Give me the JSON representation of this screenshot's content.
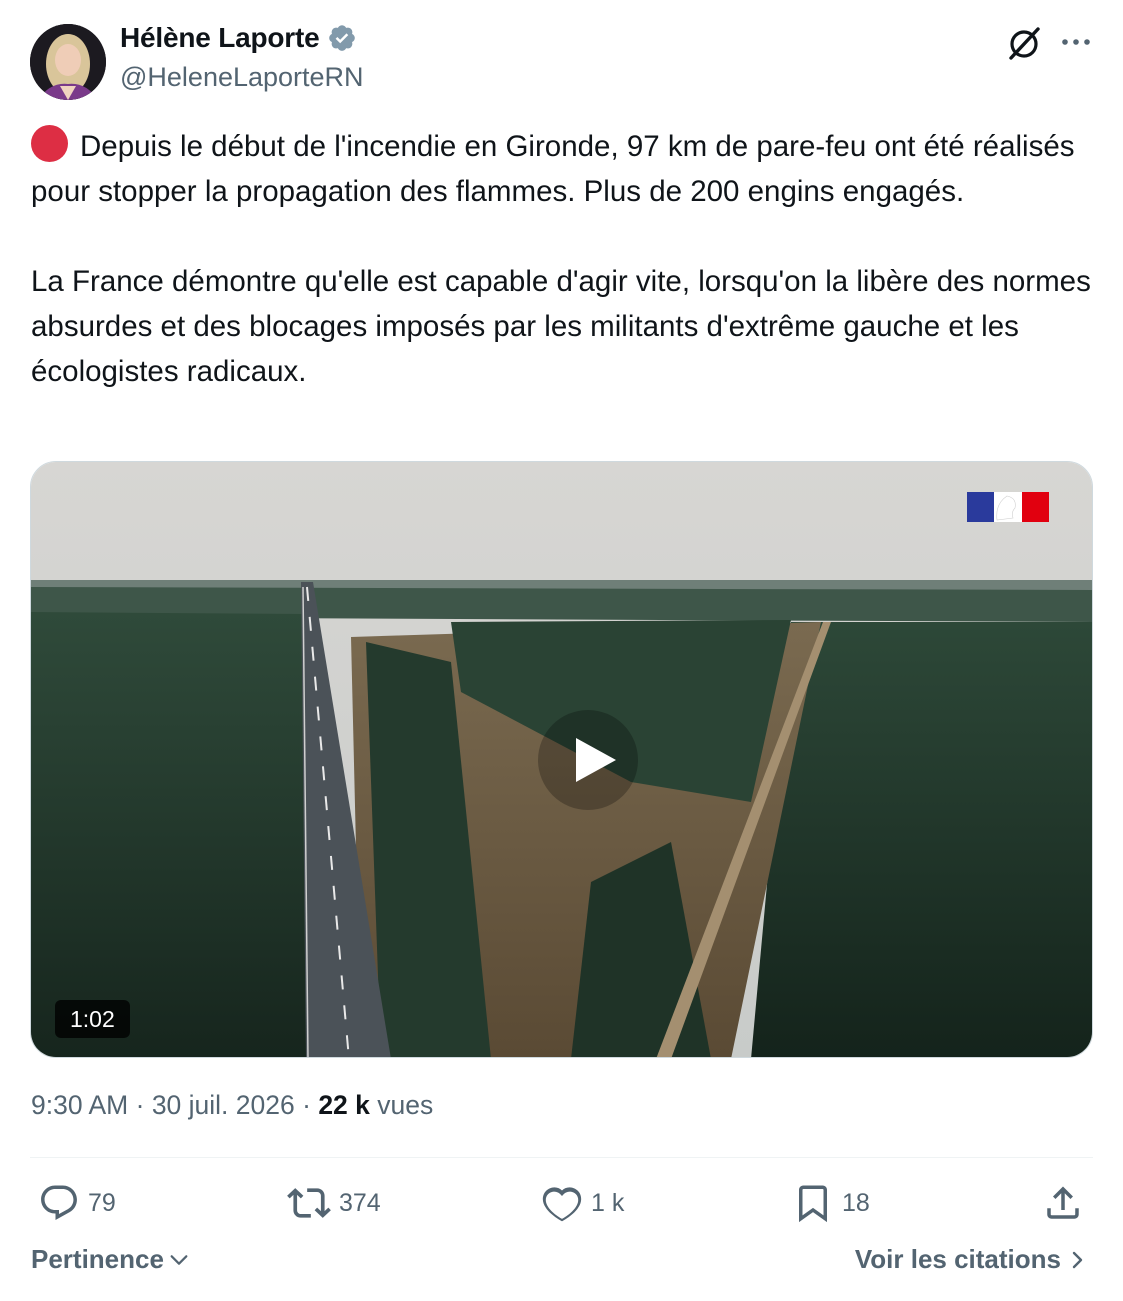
{
  "author": {
    "name": "Hélène Laporte",
    "handle": "@HeleneLaporteRN",
    "verified": true
  },
  "tweet": {
    "paragraph1": "Depuis le début de l'incendie en Gironde, 97 km de pare-feu ont été réalisés pour stopper la propagation des flammes. Plus de 200 engins engagés.",
    "paragraph2": "La France démontre qu'elle est capable d'agir vite, lorsqu'on la libère des normes absurdes et des blocages imposés par les militants d'extrême gauche et les écologistes radicaux.",
    "leading_emoji": "red-circle-icon"
  },
  "media": {
    "duration": "1:02",
    "overlay_logo": "gov-flag-logo"
  },
  "meta": {
    "time": "9:30 AM",
    "separator": "·",
    "date": "30 juil. 2026",
    "views_count": "22 k",
    "views_label": "vues"
  },
  "actions": {
    "replies": "79",
    "reposts": "374",
    "likes": "1 k",
    "bookmarks": "18"
  },
  "footer": {
    "sort_label": "Pertinence",
    "quotes_label": "Voir les citations"
  },
  "colors": {
    "text": "#0f1419",
    "secondary": "#536471",
    "verified": "#829aab",
    "emoji_red": "#dd2e44"
  }
}
